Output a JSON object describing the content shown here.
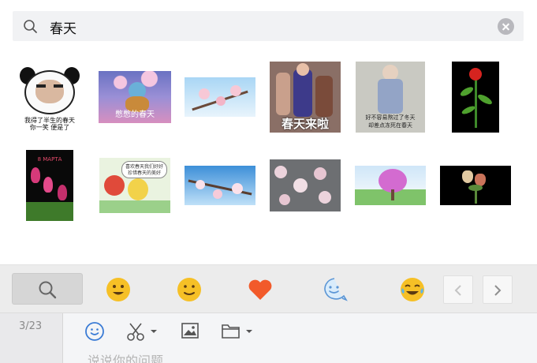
{
  "search": {
    "query": "春天"
  },
  "stickers": {
    "captions": {
      "panda_line1": "我得了半生的春天",
      "panda_line2": "你一笑 便是了",
      "squirtle": "憋憋的春天",
      "kids": "春天来啦",
      "toddler_line1": "好不容易熬过了冬天",
      "toddler_line2": "却差点冻死在春天",
      "card": "8 МАРТА",
      "cartoon_line1": "喜欢春天我们好好",
      "cartoon_line2": "珍惜春天的美好"
    }
  },
  "emoji_tabs": [
    "search-tab",
    "grinning-face",
    "smiling-face",
    "heart",
    "bubble-smile",
    "tears-of-joy"
  ],
  "input": {
    "page_indicator": "3/23",
    "placeholder": "说说你的问题"
  },
  "colors": {
    "accent": "#3a7bd5",
    "heart": "#f25a2a",
    "emoji_yellow": "#f6c026"
  }
}
